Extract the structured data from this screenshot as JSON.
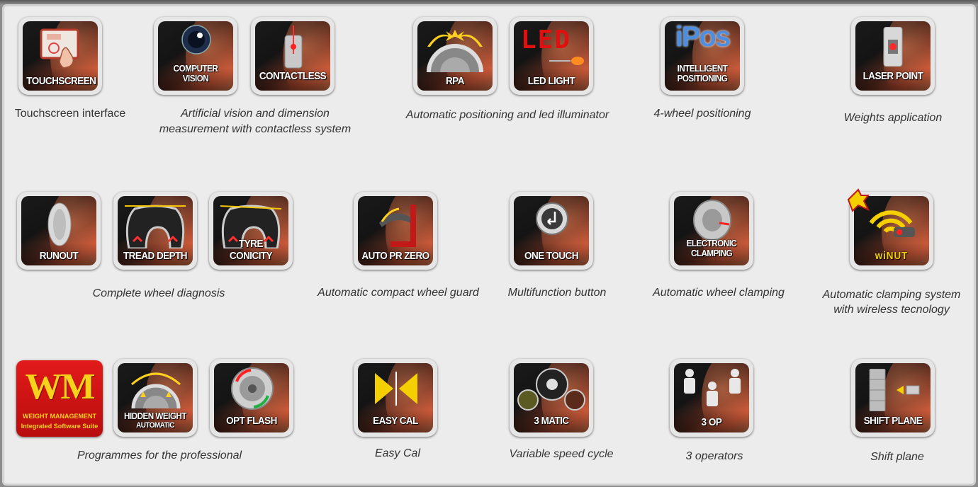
{
  "row1": {
    "touchscreen": "TOUCHSCREEN",
    "computer_vision": "COMPUTER VISION",
    "contactless": "CONTACTLESS",
    "rpa": "RPA",
    "led_light": "LED LIGHT",
    "led_art": "LED",
    "ipos_logo": "iPos",
    "intelligent_positioning": "INTELLIGENT POSITIONING",
    "laser_point": "LASER POINT",
    "cap_touchscreen": "Touchscreen interface",
    "cap_vision_1": "Artificial vision and dimension",
    "cap_vision_2": "measurement with contactless system",
    "cap_positioning": "Automatic positioning and led illuminator",
    "cap_ipos": "4-wheel positioning",
    "cap_laser": "Weights application"
  },
  "row2": {
    "runout": "RUNOUT",
    "tread_depth": "TREAD DEPTH",
    "tyre_conicity": "TYRE CONICITY",
    "auto_pr_zero": "AUTO PR ZERO",
    "one_touch": "ONE TOUCH",
    "electronic_clamping": "ELECTRONIC CLAMPING",
    "winut": "wiNUT",
    "cap_diagnosis": "Complete wheel diagnosis",
    "cap_guard": "Automatic compact wheel guard",
    "cap_button": "Multifunction button",
    "cap_clamping": "Automatic wheel clamping",
    "cap_wireless_1": "Automatic clamping system",
    "cap_wireless_2": "with wireless tecnology"
  },
  "row3": {
    "wm_logo": "WM",
    "wm_line1": "WEIGHT MANAGEMENT",
    "wm_line2": "Integrated Software Suite",
    "hidden_weight": "HIDDEN WEIGHT",
    "hidden_weight_sub": "AUTOMATIC",
    "opt_flash": "OPT FLASH",
    "easy_cal": "EASY CAL",
    "three_matic": "3 MATIC",
    "three_op": "3 OP",
    "shift_plane": "SHIFT PLANE",
    "cap_programmes": "Programmes for the professional",
    "cap_easycal": "Easy Cal",
    "cap_speed": "Variable speed cycle",
    "cap_operators": "3 operators",
    "cap_shift": "Shift plane"
  },
  "colors": {
    "panel_bg": "#ececec",
    "tile_dark": "#141414",
    "tile_accent": "#c9593a",
    "wm_red": "#e21a1a",
    "wm_yellow": "#f6d21a",
    "caption": "#333333"
  },
  "icons": [
    "touch-hand-icon",
    "camera-lens-icon",
    "laser-scan-icon",
    "wheel-arrows-icon",
    "led-bulb-icon",
    "laser-point-icon",
    "wheel-runout-icon",
    "tyre-section-icon",
    "wheel-guard-icon",
    "push-button-icon",
    "clamped-wheel-icon",
    "wifi-nut-icon",
    "hidden-weight-icon",
    "opt-wheel-icon",
    "calibration-icon",
    "speed-dials-icon",
    "operators-icon",
    "shift-plane-icon"
  ]
}
